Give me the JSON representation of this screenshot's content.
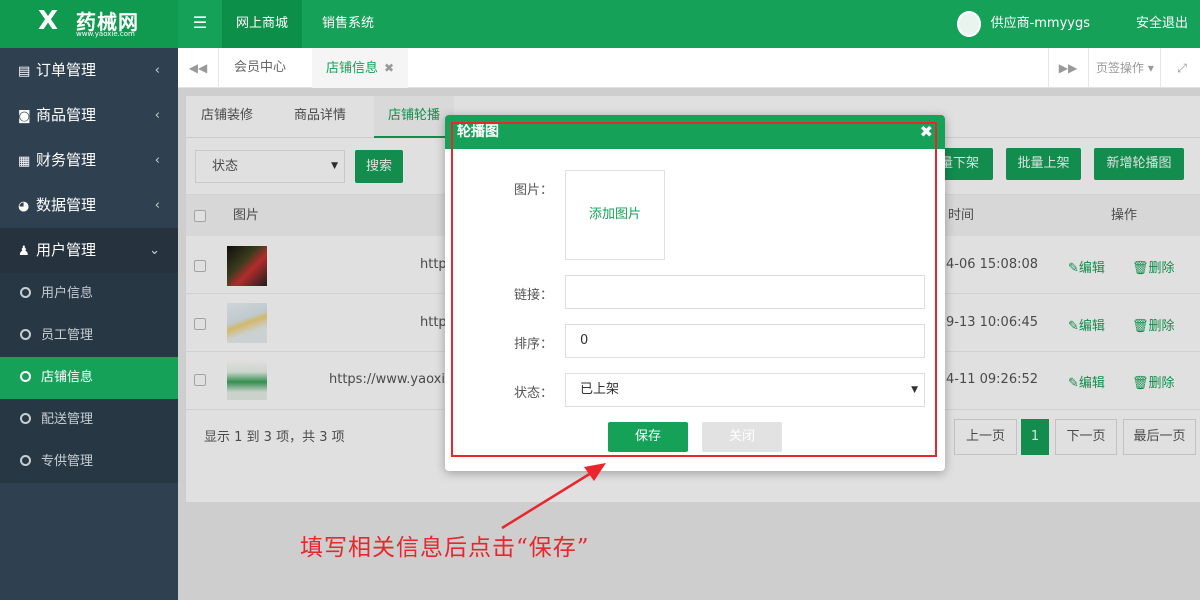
{
  "brand": {
    "name": "药械网",
    "sub": "www.yaoxie.com",
    "mark": "X"
  },
  "topnav": {
    "menu_icon": "menu-icon",
    "items": [
      "网上商城",
      "销售系统"
    ],
    "user": "供应商-mmyygs",
    "logout": "安全退出"
  },
  "sidebar": {
    "menus": [
      {
        "label": "订单管理",
        "icon": "document-icon"
      },
      {
        "label": "商品管理",
        "icon": "bag-icon"
      },
      {
        "label": "财务管理",
        "icon": "calculator-icon"
      },
      {
        "label": "数据管理",
        "icon": "pie-chart-icon"
      },
      {
        "label": "用户管理",
        "icon": "user-icon"
      }
    ],
    "subs": [
      "用户信息",
      "员工管理",
      "店铺信息",
      "配送管理",
      "专供管理"
    ]
  },
  "tabs": {
    "items": [
      "会员中心",
      "店铺信息"
    ],
    "page_ops": "页签操作"
  },
  "subtabs": [
    "店铺装修",
    "商品详情",
    "店铺轮播"
  ],
  "filter": {
    "status": "状态",
    "search": "搜索"
  },
  "actions": {
    "off": "量下架",
    "on": "批量上架",
    "add": "新增轮播图"
  },
  "table": {
    "headers": {
      "pic": "图片",
      "time": "时间",
      "ops": "操作"
    },
    "rows": [
      {
        "link": "https",
        "time": "4-06 15:08:08"
      },
      {
        "link": "http",
        "time": "9-13 10:06:45"
      },
      {
        "link": "https://www.yaoxie.c",
        "time": "4-11 09:26:52"
      }
    ],
    "edit": "编辑",
    "delete": "删除"
  },
  "pager": {
    "info": "显示 1 到 3 项，共 3 项",
    "prev": "上一页",
    "page": "1",
    "next": "下一页",
    "last": "最后一页"
  },
  "modal": {
    "title": "轮播图",
    "fields": {
      "image": "图片：",
      "link": "链接：",
      "sort": "排序：",
      "status": "状态："
    },
    "upload": "添加图片",
    "link_value": "",
    "sort_value": "0",
    "status_value": "已上架",
    "save": "保存",
    "close": "关闭"
  },
  "annotation": "填写相关信息后点击“保存”",
  "colors": {
    "brand_green": "#15a158",
    "sidebar": "#2f4050",
    "annotation_red": "#e8262b"
  }
}
